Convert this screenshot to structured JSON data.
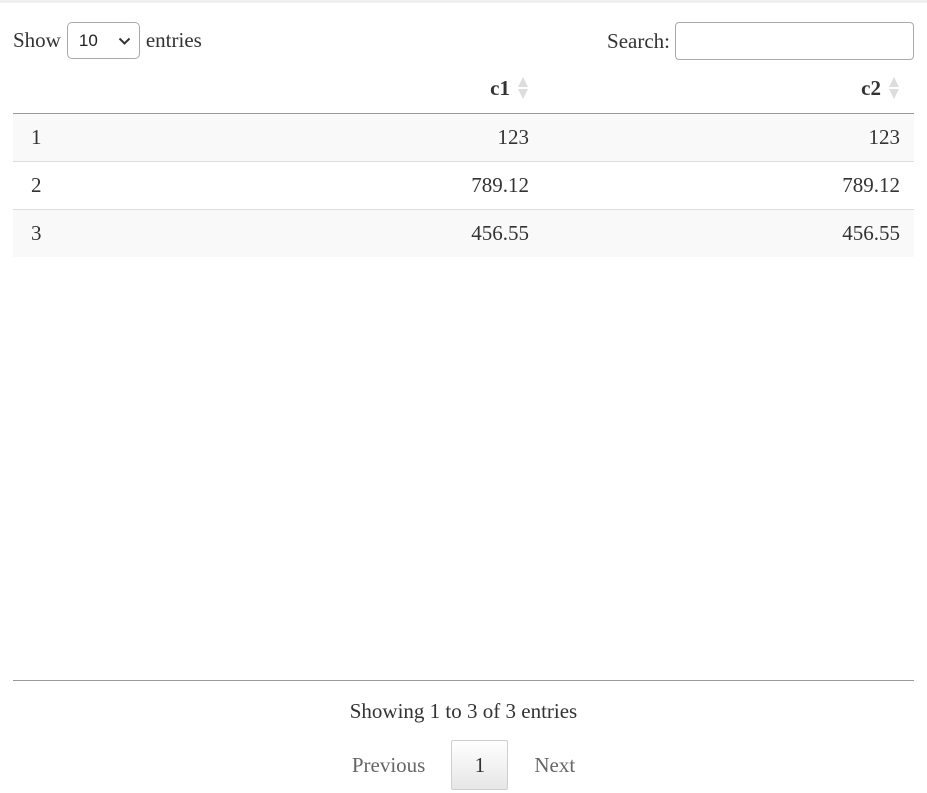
{
  "length_control": {
    "label_before": "Show",
    "selected_value": "10",
    "label_after": "entries"
  },
  "search": {
    "label": "Search:",
    "value": "",
    "placeholder": ""
  },
  "table": {
    "columns": [
      {
        "label": ""
      },
      {
        "label": "c1"
      },
      {
        "label": "c2"
      }
    ],
    "rows": [
      {
        "index": "1",
        "c1": "123",
        "c2": "123"
      },
      {
        "index": "2",
        "c1": "789.12",
        "c2": "789.12"
      },
      {
        "index": "3",
        "c1": "456.55",
        "c2": "456.55"
      }
    ]
  },
  "info": {
    "text": "Showing 1 to 3 of 3 entries"
  },
  "pagination": {
    "previous_label": "Previous",
    "current_page": "1",
    "next_label": "Next"
  },
  "icons": {
    "select_arrow": "chevron-down-icon",
    "sort": "sort-icon"
  },
  "colors": {
    "text": "#333333",
    "row_stripe": "#f9f9f9",
    "sort_icon": "#dddddd",
    "pager_text": "#666666"
  }
}
